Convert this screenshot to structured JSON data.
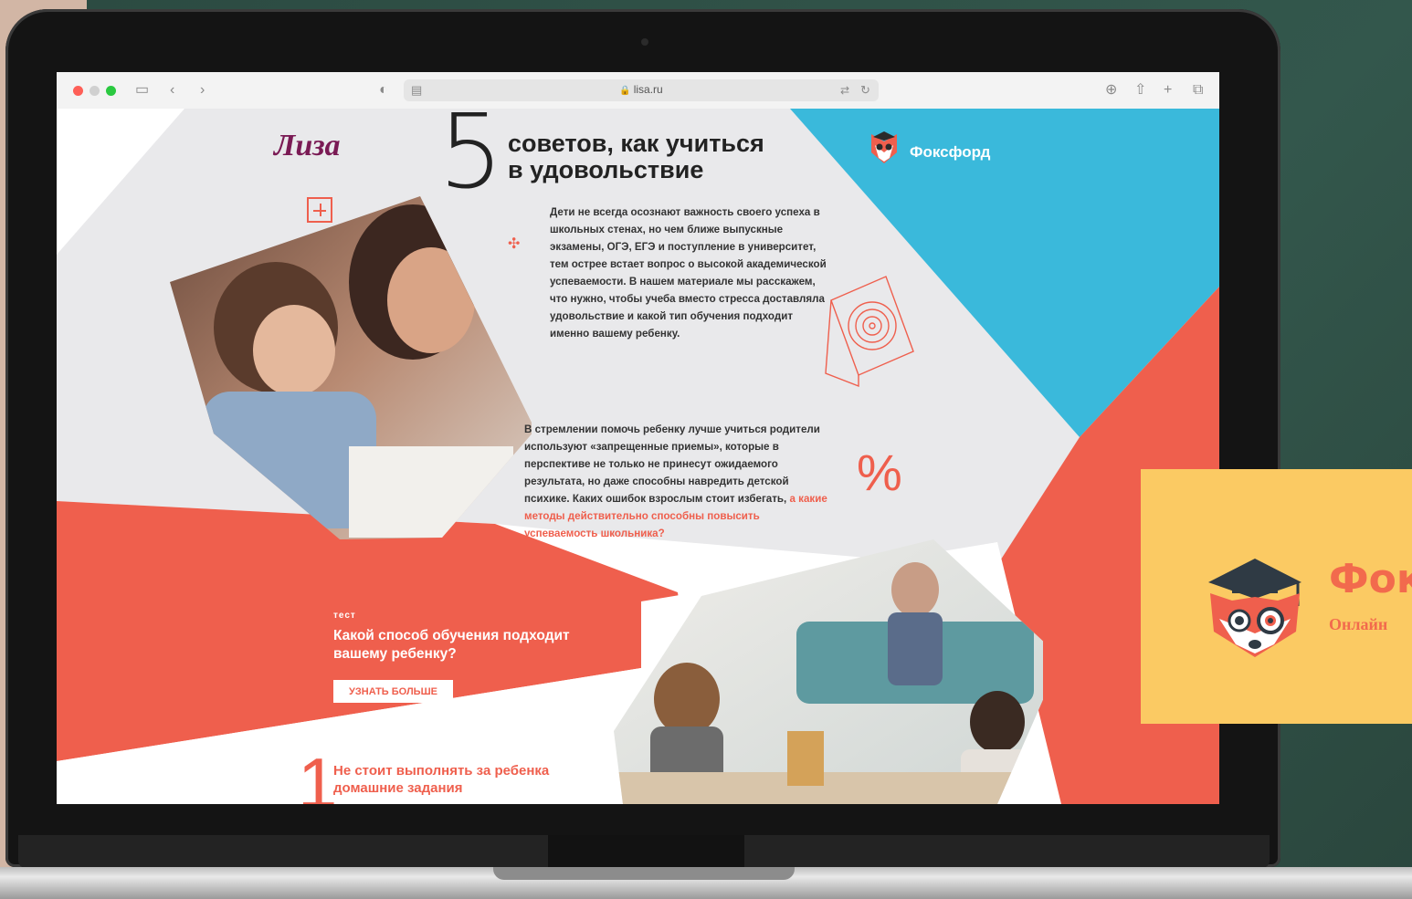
{
  "browser": {
    "url": "lisa.ru"
  },
  "page": {
    "lisa_logo": "Лиза",
    "big_number": "5",
    "headline_line1": "советов, как учиться",
    "headline_line2": "в удовольствие",
    "foxford_label": "Фоксфорд",
    "intro": "Дети не всегда осознают важность своего успеха в школьных стенах, но чем ближе выпускные экзамены, ОГЭ, ЕГЭ и поступление в университет, тем острее встает вопрос о высокой академической успеваемости. В нашем материале мы расскажем, что нужно, чтобы учеба вместо стресса доставляла удовольствие и какой тип обучения подходит именно вашему ребенку.",
    "para2_text": "В стремлении помочь ребенку лучше учиться родители используют «запрещенные приемы», которые в перспективе не только не принесут ожидаемого результата, но даже способны навредить детской психике. Каких ошибок взрослым стоит избегать,",
    "para2_link": " а какие методы действительно способны повысить успеваемость школьника?",
    "percent_sign": "%",
    "test_tag": "тест",
    "test_question": "Какой способ обучения подходит вашему ребенку?",
    "test_button": "УЗНАТЬ БОЛЬШЕ",
    "tip1_number": "1",
    "tip1_title": "Не стоит выполнять за ребенка домашние задания"
  },
  "card": {
    "brand": "Фок",
    "subtitle": "Онлайн"
  },
  "colors": {
    "coral": "#ef5f4d",
    "sky": "#3ab9db",
    "plum": "#7a1a54",
    "card_yellow": "#fbca63"
  }
}
